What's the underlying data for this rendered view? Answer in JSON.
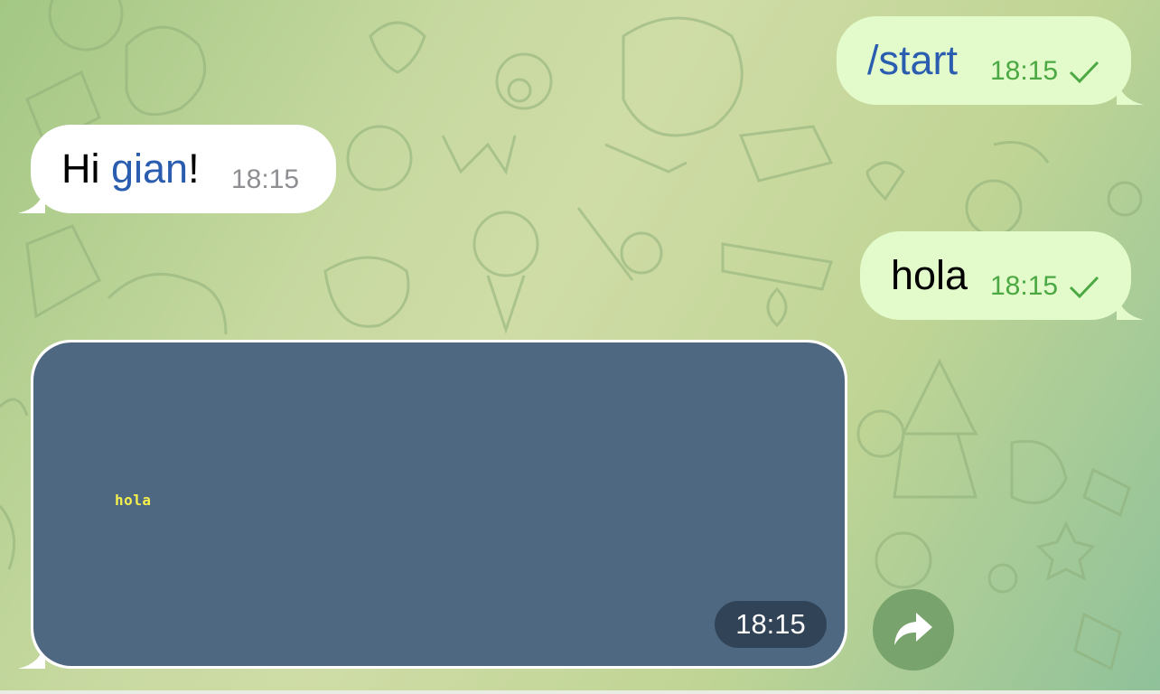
{
  "chat": {
    "messages": [
      {
        "direction": "outgoing",
        "text": "/start",
        "time": "18:15",
        "status": "sent-check-icon"
      },
      {
        "direction": "incoming",
        "text_prefix": "Hi ",
        "mention": "gian",
        "text_suffix": "!",
        "time": "18:15"
      },
      {
        "direction": "outgoing",
        "text": "hola",
        "time": "18:15",
        "status": "sent-check-icon"
      },
      {
        "direction": "incoming",
        "type": "image",
        "caption": "hola",
        "time": "18:15"
      }
    ],
    "share_icon": "share-arrow-icon"
  },
  "colors": {
    "outgoing_bubble": "#e3fbcb",
    "incoming_bubble": "#ffffff",
    "link": "#2a5db0",
    "outgoing_time": "#4ba842",
    "media_background": "#4f6882",
    "media_text": "#f4ef4c"
  }
}
